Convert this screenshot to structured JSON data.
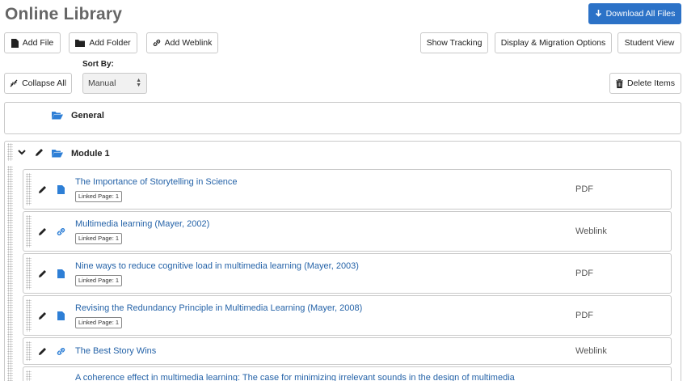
{
  "header": {
    "title": "Online Library",
    "download_all_label": "Download All Files"
  },
  "toolbar": {
    "add_file_label": "Add File",
    "add_folder_label": "Add Folder",
    "add_weblink_label": "Add Weblink",
    "show_tracking_label": "Show Tracking",
    "display_migration_label": "Display & Migration Options",
    "student_view_label": "Student View",
    "collapse_all_label": "Collapse All",
    "sort_by_label": "Sort By:",
    "sort_by_value": "Manual",
    "delete_items_label": "Delete Items"
  },
  "folders": [
    {
      "name": "General",
      "icon": "folder-open-icon"
    },
    {
      "name": "Module 1",
      "icon": "folder-open-icon",
      "expanded": true
    }
  ],
  "module_items": [
    {
      "title": "The Importance of Storytelling in Science",
      "badge": "Linked Page: 1",
      "type": "PDF",
      "icon": "file-icon"
    },
    {
      "title": "Multimedia learning (Mayer, 2002)",
      "badge": "Linked Page: 1",
      "type": "Weblink",
      "icon": "link-icon"
    },
    {
      "title": "Nine ways to reduce cognitive load in multimedia learning (Mayer, 2003)",
      "badge": "Linked Page: 1",
      "type": "PDF",
      "icon": "file-icon"
    },
    {
      "title": "Revising the Redundancy Principle in Multimedia Learning (Mayer, 2008)",
      "badge": "Linked Page: 1",
      "type": "PDF",
      "icon": "file-icon"
    },
    {
      "title": "The Best Story Wins",
      "type": "Weblink",
      "icon": "link-icon"
    },
    {
      "title": "A coherence effect in multimedia learning: The case for minimizing irrelevant sounds in the design of multimedia"
    }
  ],
  "colors": {
    "primary": "#2c72c7",
    "link": "#2563a8",
    "icon_blue": "#2e7fd6"
  }
}
